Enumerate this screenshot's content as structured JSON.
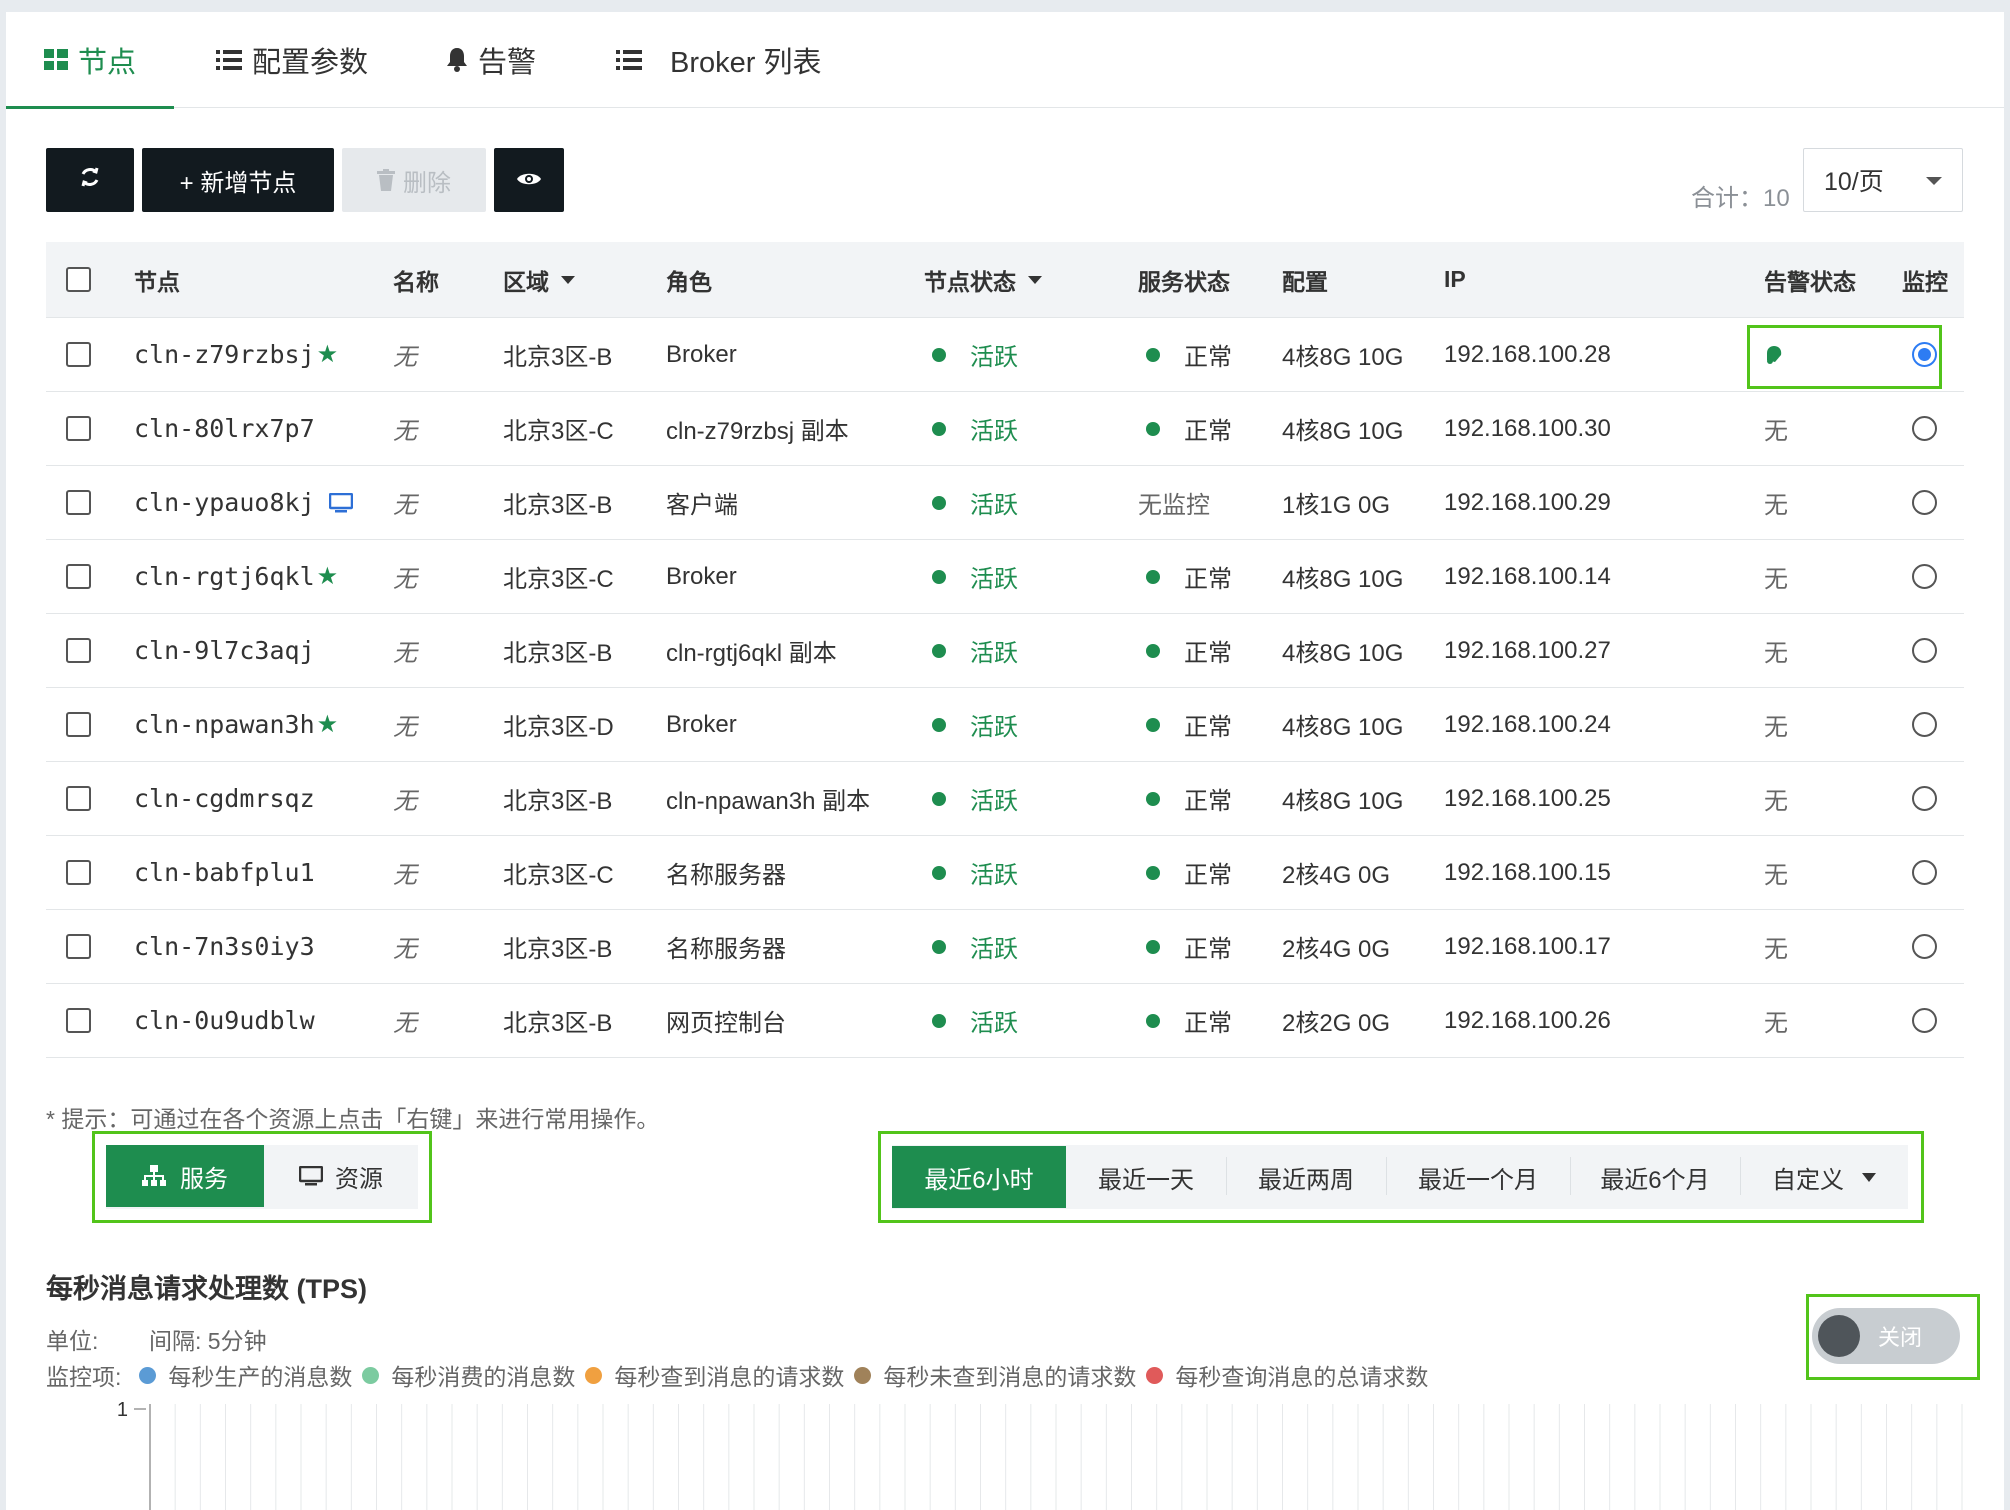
{
  "tabs": [
    {
      "label": "节点",
      "icon": "grid-icon",
      "active": true
    },
    {
      "label": "配置参数",
      "icon": "list-icon",
      "active": false
    },
    {
      "label": "告警",
      "icon": "bell-icon",
      "active": false
    },
    {
      "label": "Broker 列表",
      "icon": "list-icon",
      "active": false
    }
  ],
  "toolbar": {
    "refresh_icon": "refresh-icon",
    "add_label": "+ 新增节点",
    "delete_label": "删除",
    "eye_icon": "eye-icon",
    "total_label": "合计：10",
    "page_size": "10/页"
  },
  "table": {
    "headers": {
      "node": "节点",
      "name": "名称",
      "region": "区域",
      "role": "角色",
      "node_status": "节点状态",
      "service_status": "服务状态",
      "config": "配置",
      "ip": "IP",
      "alert_status": "告警状态",
      "monitor": "监控"
    },
    "rows": [
      {
        "node": "cln-z79rzbsj",
        "badge": "star-icon",
        "name": "无",
        "region": "北京3区-B",
        "role": "Broker",
        "node_status": "活跃",
        "service_status": "正常",
        "config": "4核8G 10G",
        "ip": "192.168.100.28",
        "alert": "",
        "monitor_selected": true
      },
      {
        "node": "cln-80lrx7p7",
        "badge": "",
        "name": "无",
        "region": "北京3区-C",
        "role": "cln-z79rzbsj 副本",
        "node_status": "活跃",
        "service_status": "正常",
        "config": "4核8G 10G",
        "ip": "192.168.100.30",
        "alert": "无",
        "monitor_selected": false
      },
      {
        "node": "cln-ypauo8kj",
        "badge": "monitor-icon",
        "name": "无",
        "region": "北京3区-B",
        "role": "客户端",
        "node_status": "活跃",
        "service_status": "无监控",
        "config": "1核1G 0G",
        "ip": "192.168.100.29",
        "alert": "无",
        "monitor_selected": false
      },
      {
        "node": "cln-rgtj6qkl",
        "badge": "star-icon",
        "name": "无",
        "region": "北京3区-C",
        "role": "Broker",
        "node_status": "活跃",
        "service_status": "正常",
        "config": "4核8G 10G",
        "ip": "192.168.100.14",
        "alert": "无",
        "monitor_selected": false
      },
      {
        "node": "cln-9l7c3aqj",
        "badge": "",
        "name": "无",
        "region": "北京3区-B",
        "role": "cln-rgtj6qkl 副本",
        "node_status": "活跃",
        "service_status": "正常",
        "config": "4核8G 10G",
        "ip": "192.168.100.27",
        "alert": "无",
        "monitor_selected": false
      },
      {
        "node": "cln-npawan3h",
        "badge": "star-icon",
        "name": "无",
        "region": "北京3区-D",
        "role": "Broker",
        "node_status": "活跃",
        "service_status": "正常",
        "config": "4核8G 10G",
        "ip": "192.168.100.24",
        "alert": "无",
        "monitor_selected": false
      },
      {
        "node": "cln-cgdmrsqz",
        "badge": "",
        "name": "无",
        "region": "北京3区-B",
        "role": "cln-npawan3h 副本",
        "node_status": "活跃",
        "service_status": "正常",
        "config": "4核8G 10G",
        "ip": "192.168.100.25",
        "alert": "无",
        "monitor_selected": false
      },
      {
        "node": "cln-babfplu1",
        "badge": "",
        "name": "无",
        "region": "北京3区-C",
        "role": "名称服务器",
        "node_status": "活跃",
        "service_status": "正常",
        "config": "2核4G 0G",
        "ip": "192.168.100.15",
        "alert": "无",
        "monitor_selected": false
      },
      {
        "node": "cln-7n3s0iy3",
        "badge": "",
        "name": "无",
        "region": "北京3区-B",
        "role": "名称服务器",
        "node_status": "活跃",
        "service_status": "正常",
        "config": "2核4G 0G",
        "ip": "192.168.100.17",
        "alert": "无",
        "monitor_selected": false
      },
      {
        "node": "cln-0u9udblw",
        "badge": "",
        "name": "无",
        "region": "北京3区-B",
        "role": "网页控制台",
        "node_status": "活跃",
        "service_status": "正常",
        "config": "2核2G 0G",
        "ip": "192.168.100.26",
        "alert": "无",
        "monitor_selected": false
      }
    ]
  },
  "hint": "* 提示：可通过在各个资源上点击「右键」来进行常用操作。",
  "view_switch": [
    {
      "label": "服务",
      "icon": "sitemap-icon",
      "active": true
    },
    {
      "label": "资源",
      "icon": "monitor-icon",
      "active": false
    }
  ],
  "time_ranges": [
    {
      "label": "最近6小时",
      "active": true
    },
    {
      "label": "最近一天",
      "active": false
    },
    {
      "label": "最近两周",
      "active": false
    },
    {
      "label": "最近一个月",
      "active": false
    },
    {
      "label": "最近6个月",
      "active": false
    },
    {
      "label": "自定义",
      "active": false,
      "dropdown": true
    }
  ],
  "chart": {
    "title": "每秒消息请求处理数 (TPS)",
    "unit_label": "单位:",
    "interval_label": "间隔: 5分钟",
    "legend_label": "监控项:",
    "toggle_label": "关闭",
    "toggle_on": false,
    "y_max_label": "1"
  },
  "chart_data": {
    "type": "line",
    "title": "每秒消息请求处理数 (TPS)",
    "series": [
      {
        "name": "每秒生产的消息数",
        "color": "#5b9bd5",
        "values": []
      },
      {
        "name": "每秒消费的消息数",
        "color": "#7ccba0",
        "values": []
      },
      {
        "name": "每秒查到消息的请求数",
        "color": "#f0a040",
        "values": []
      },
      {
        "name": "每秒未查到消息的请求数",
        "color": "#a0825a",
        "values": []
      },
      {
        "name": "每秒查询消息的总请求数",
        "color": "#e05a5a",
        "values": []
      }
    ],
    "y_tick_labels": [
      "1"
    ],
    "grid": true
  },
  "colors": {
    "primary": "#1e8d4f",
    "dark_button": "#121a1f",
    "highlight": "#52c41a",
    "radio_selected": "#2d7cf3"
  }
}
